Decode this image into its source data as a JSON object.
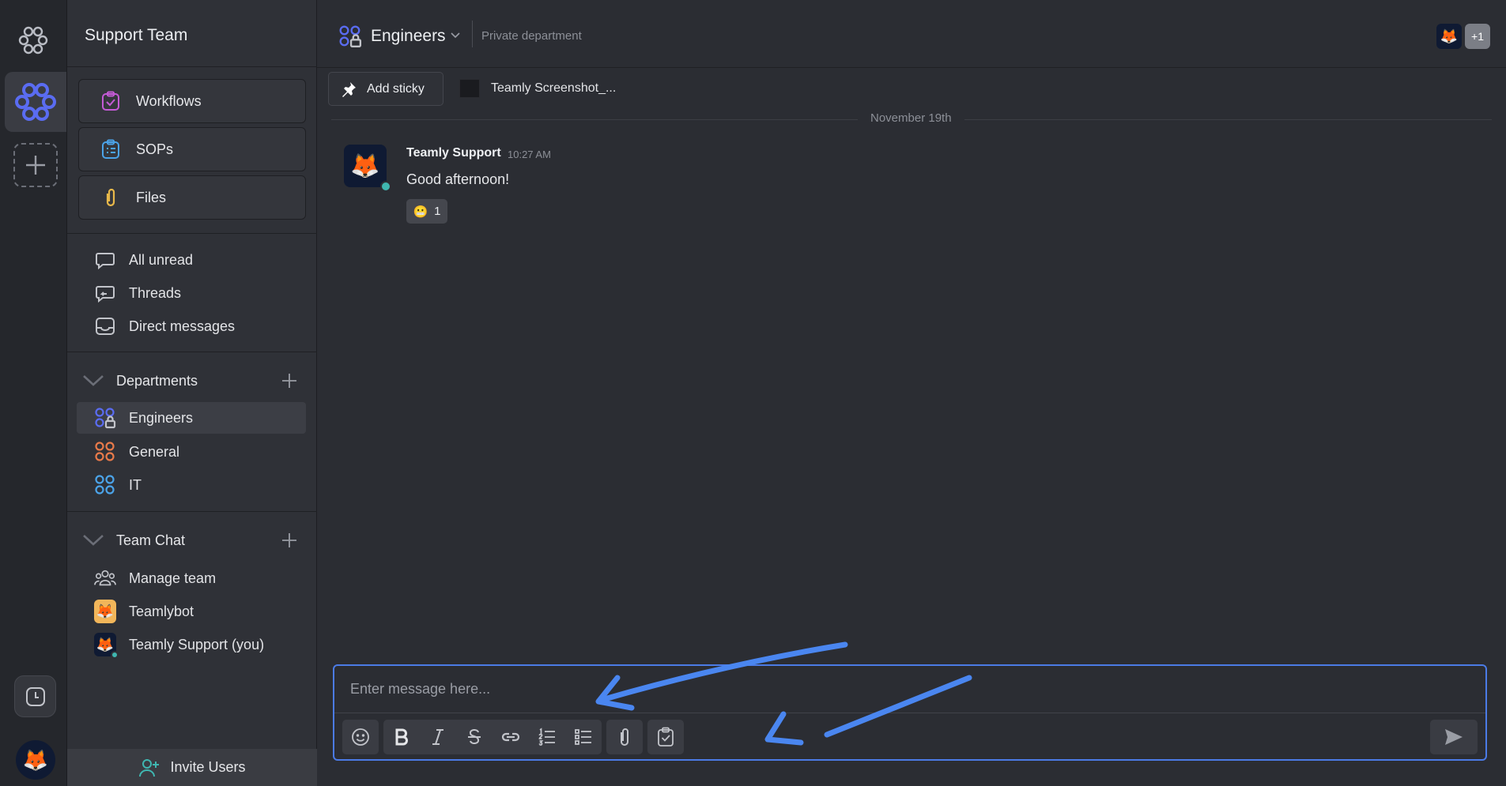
{
  "workspace": {
    "title": "Support Team"
  },
  "sidebar": {
    "tools": [
      {
        "label": "Workflows",
        "icon": "workflow-icon"
      },
      {
        "label": "SOPs",
        "icon": "sop-icon"
      },
      {
        "label": "Files",
        "icon": "paperclip-icon"
      }
    ],
    "nav": [
      {
        "label": "All unread",
        "icon": "chat-bubble-icon"
      },
      {
        "label": "Threads",
        "icon": "threads-icon"
      },
      {
        "label": "Direct messages",
        "icon": "inbox-icon"
      }
    ],
    "departments": {
      "heading": "Departments",
      "items": [
        {
          "label": "Engineers",
          "color": "#5a6cf2",
          "active": true
        },
        {
          "label": "General",
          "color": "#e87a4a"
        },
        {
          "label": "IT",
          "color": "#4ba3e8"
        }
      ]
    },
    "team_chat": {
      "heading": "Team Chat",
      "items": [
        {
          "label": "Manage team"
        },
        {
          "label": "Teamlybot"
        },
        {
          "label": "Teamly Support (you)"
        }
      ]
    },
    "invite_label": "Invite Users"
  },
  "channel": {
    "name": "Engineers",
    "description": "Private department",
    "member_extra": "+1"
  },
  "toolbar": {
    "sticky_label": "Add sticky",
    "file_label": "Teamly Screenshot_..."
  },
  "messages": {
    "date_label": "November 19th",
    "items": [
      {
        "author": "Teamly Support",
        "time": "10:27 AM",
        "text": "Good afternoon!",
        "reaction_emoji": "😬",
        "reaction_count": "1"
      }
    ]
  },
  "composer": {
    "placeholder": "Enter message here..."
  },
  "colors": {
    "accent": "#4b7be6",
    "annotation": "#4a86f0",
    "online": "#3fb6b0"
  }
}
